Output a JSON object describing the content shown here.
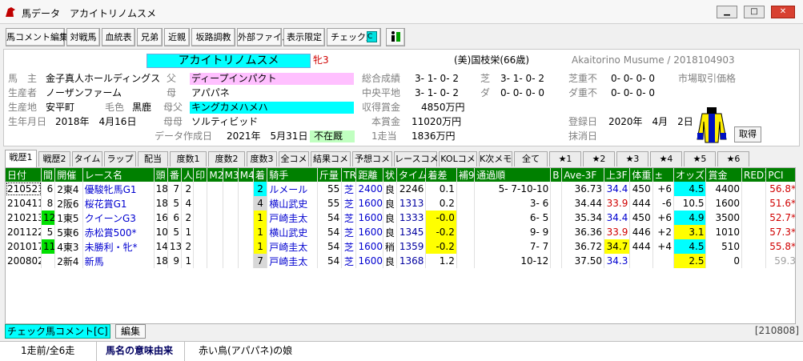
{
  "window": {
    "title": "馬データ　アカイトリノムスメ",
    "min": "▁",
    "max": "□",
    "close": "✕"
  },
  "toolbar": {
    "buttons": [
      "馬コメント編集",
      "対戦馬",
      "血統表",
      "兄弟",
      "近親",
      "坂路調教",
      "外部ファイル",
      "表示限定",
      "チェック馬"
    ]
  },
  "horse": {
    "name": "アカイトリノムスメ",
    "sexage": "牝3",
    "trainer": "(美)国枝栄(66歳)",
    "romaji": "Akaitorino Musume / 2018104903",
    "owner_label": "馬　主",
    "owner": "金子真人ホールディングス",
    "breeder_label": "生産者",
    "breeder": "ノーザンファーム",
    "area_label": "生産地",
    "area": "安平町",
    "color_label": "毛色",
    "color": "黒鹿",
    "birth_label": "生年月日",
    "birth": "2018年　4月16日",
    "sire_label": "父",
    "sire": "ディープインパクト",
    "dam_label": "母",
    "dam": "アパパネ",
    "damsire_label": "母父",
    "damsire": "キングカメハメハ",
    "damdam_label": "母母",
    "damdam": "ソルティビッド",
    "created_label": "データ作成日",
    "created": "2021年　5月31日",
    "status": "不在厩",
    "total_label": "総合成績",
    "total": "3- 1- 0- 2",
    "shiba_label": "芝",
    "shiba": "3- 1- 0- 2",
    "central_label": "中央平地",
    "central": "3- 1- 0- 2",
    "dirt_label": "ダ",
    "dirt": "0- 0- 0- 0",
    "prize_label": "収得賞金",
    "prize": "4850万円",
    "main_label": "本賞金",
    "main": "11020万円",
    "per_label": "1走当",
    "per": "1836万円",
    "heavy_label": "芝重不",
    "heavy": "0- 0- 0- 0",
    "dheavy_label": "ダ重不",
    "dheavy": "0- 0- 0- 0",
    "market": "市場取引価格",
    "reg_label": "登録日",
    "reg": "2020年　4月　2日",
    "del_label": "抹消日",
    "get_btn": "取得"
  },
  "tabs": [
    "戦歴1",
    "戦歴2",
    "タイム",
    "ラップ",
    "配当",
    "度数1",
    "度数2",
    "度数3",
    "全コメ",
    "結果コメ",
    "予想コメ",
    "レースコメ",
    "KOLコメ",
    "K次メモ",
    "全て",
    "★1",
    "★2",
    "★3",
    "★4",
    "★5",
    "★6"
  ],
  "columns": [
    "日付",
    "間",
    "開催",
    "レース名",
    "頭",
    "番",
    "人",
    "印",
    "M2",
    "M3",
    "M4",
    "着",
    "騎手",
    "斤量",
    "TR",
    "距離",
    "状",
    "タイム",
    "着差",
    "補9",
    "通過順",
    "B",
    "Ave-3F",
    "上3F",
    "体重",
    "±",
    "オッズ",
    "賞金",
    "RED1",
    "PCI"
  ],
  "rows": [
    [
      "210523",
      "6",
      "2東4",
      "優駿牝馬G1",
      "18",
      "7",
      "2",
      "",
      "",
      "",
      "",
      "2",
      "ルメール",
      "55",
      "芝",
      "2400",
      "良",
      "2246",
      "0.1",
      "",
      "5- 7-10-10",
      "",
      "36.73",
      "34.4",
      "450",
      "+6",
      "4.5",
      "4400",
      "",
      "56.8*"
    ],
    [
      "210411",
      "8",
      "2阪6",
      "桜花賞G1",
      "18",
      "5",
      "4",
      "",
      "",
      "",
      "",
      "4",
      "横山武史",
      "55",
      "芝",
      "1600",
      "良",
      "1313",
      "0.2",
      "",
      "3- 6",
      "",
      "34.44",
      "33.9",
      "444",
      "-6",
      "10.5",
      "1600",
      "",
      "51.6*"
    ],
    [
      "210213",
      "12",
      "1東5",
      "クイーンG3",
      "16",
      "6",
      "2",
      "",
      "",
      "",
      "",
      "1",
      "戸崎圭太",
      "54",
      "芝",
      "1600",
      "良",
      "1333",
      "-0.0",
      "",
      "6- 5",
      "",
      "35.34",
      "34.4",
      "450",
      "+6",
      "4.9",
      "3500",
      "",
      "52.7*"
    ],
    [
      "201122",
      "5",
      "5東6",
      "赤松賞500*",
      "10",
      "5",
      "1",
      "",
      "",
      "",
      "",
      "1",
      "横山武史",
      "54",
      "芝",
      "1600",
      "良",
      "1345",
      "-0.2",
      "",
      "9- 9",
      "",
      "36.36",
      "33.9",
      "446",
      "+2",
      "3.1",
      "1010",
      "",
      "57.3*"
    ],
    [
      "201017",
      "11",
      "4東3",
      "未勝利・牝*",
      "14",
      "13",
      "2",
      "",
      "",
      "",
      "",
      "1",
      "戸崎圭太",
      "54",
      "芝",
      "1600",
      "稍",
      "1359",
      "-0.2",
      "",
      "7- 7",
      "",
      "36.72",
      "34.7",
      "444",
      "+4",
      "4.5",
      "510",
      "",
      "55.8*"
    ],
    [
      "200802",
      "",
      "2新4",
      "新馬",
      "18",
      "9",
      "1",
      "",
      "",
      "",
      "",
      "7",
      "戸崎圭太",
      "54",
      "芝",
      "1600",
      "良",
      "1368",
      "1.2",
      "",
      "10-12",
      "",
      "37.50",
      "34.3",
      "",
      "",
      "2.5",
      "0",
      "",
      "59.3"
    ]
  ],
  "footer": {
    "check_comment": "チェック馬コメント[C]",
    "edit": "編集",
    "code": "[210808]",
    "count": "1走前/全6走",
    "meaning_label": "馬名の意味由来",
    "meaning": "赤い鳥(アパパネ)の娘"
  },
  "colors": {
    "header_green": "#008000",
    "cyan": "#00ffff",
    "pink": "#ffc0ff",
    "yellow": "#ffff00"
  }
}
